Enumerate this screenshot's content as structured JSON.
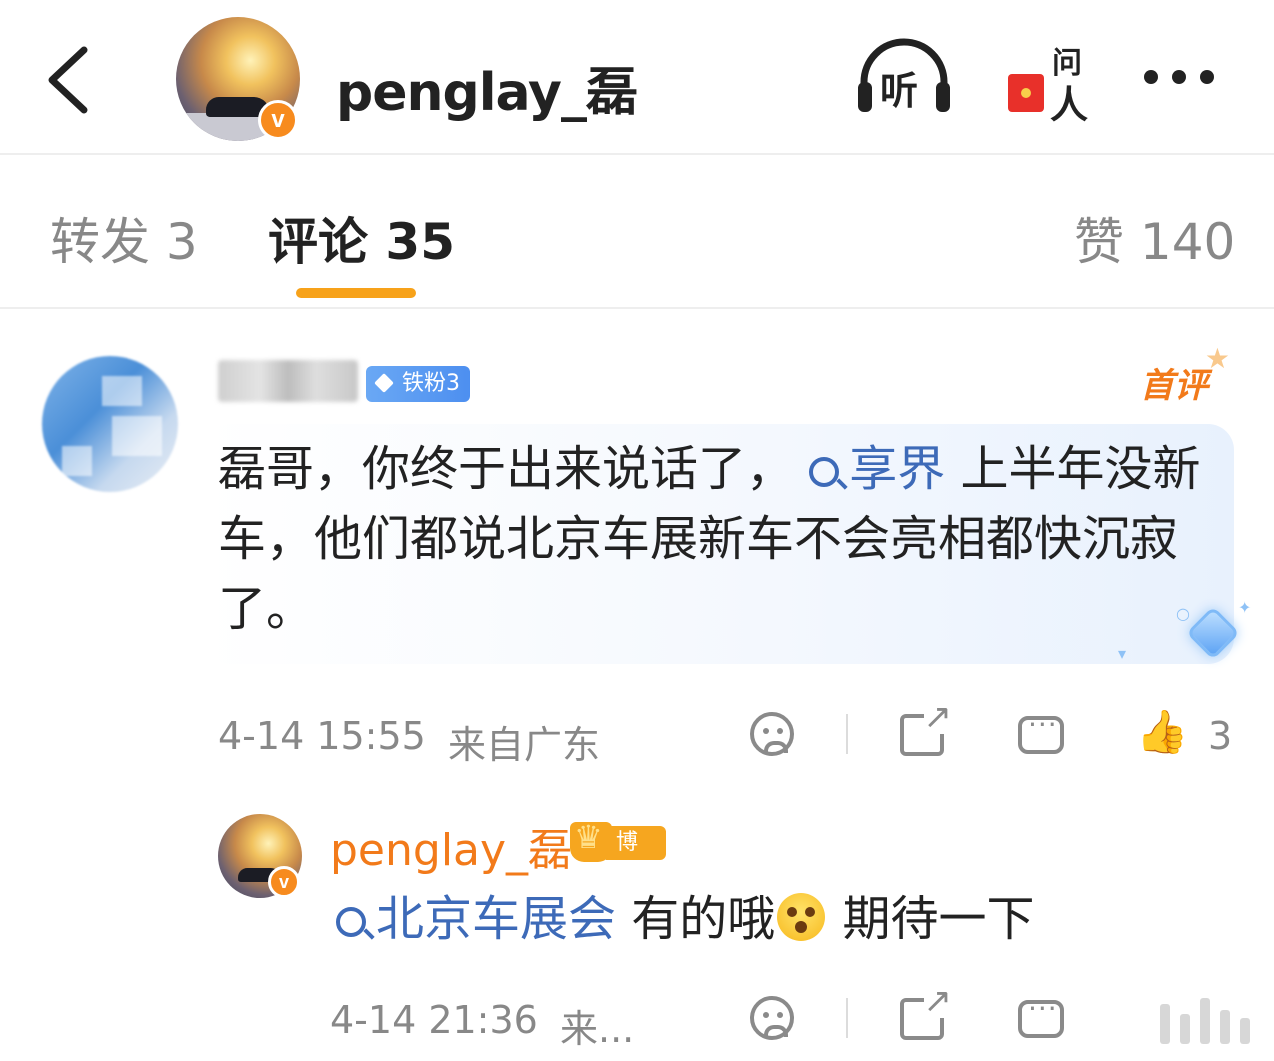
{
  "header": {
    "username": "penglay_磊",
    "verified_badge": "v",
    "listen_label": "听",
    "ask_label_top": "问",
    "ask_label_bottom": "人"
  },
  "tabs": [
    {
      "label": "转发 3",
      "active": false
    },
    {
      "label": "评论 35",
      "active": true
    },
    {
      "label": "赞 140",
      "active": false
    }
  ],
  "colors": {
    "accent": "#f7a21a",
    "topic_link": "#3d6ab8",
    "reply_name": "#f27a1a"
  },
  "comment": {
    "fan_badge": "铁粉3",
    "first_badge": "首评",
    "text_part1": "磊哥，你终于出来说话了，",
    "topic": "享界",
    "text_part2": " 上半年没新车，他们都说北京车展新车不会亮相都快沉寂了。",
    "timestamp": "4-14 15:55",
    "location": "来自广东",
    "like_count": "3",
    "icons": [
      "dislike-face-icon",
      "share-icon",
      "comment-icon",
      "thumbs-up-icon"
    ]
  },
  "reply": {
    "username": "penglay_磊",
    "badge_label": "博主",
    "verified_badge": "v",
    "topic": "北京车展会",
    "text_part1": " 有的哦",
    "text_part2": " 期待一下",
    "timestamp": "4-14 21:36",
    "location": "来..."
  }
}
